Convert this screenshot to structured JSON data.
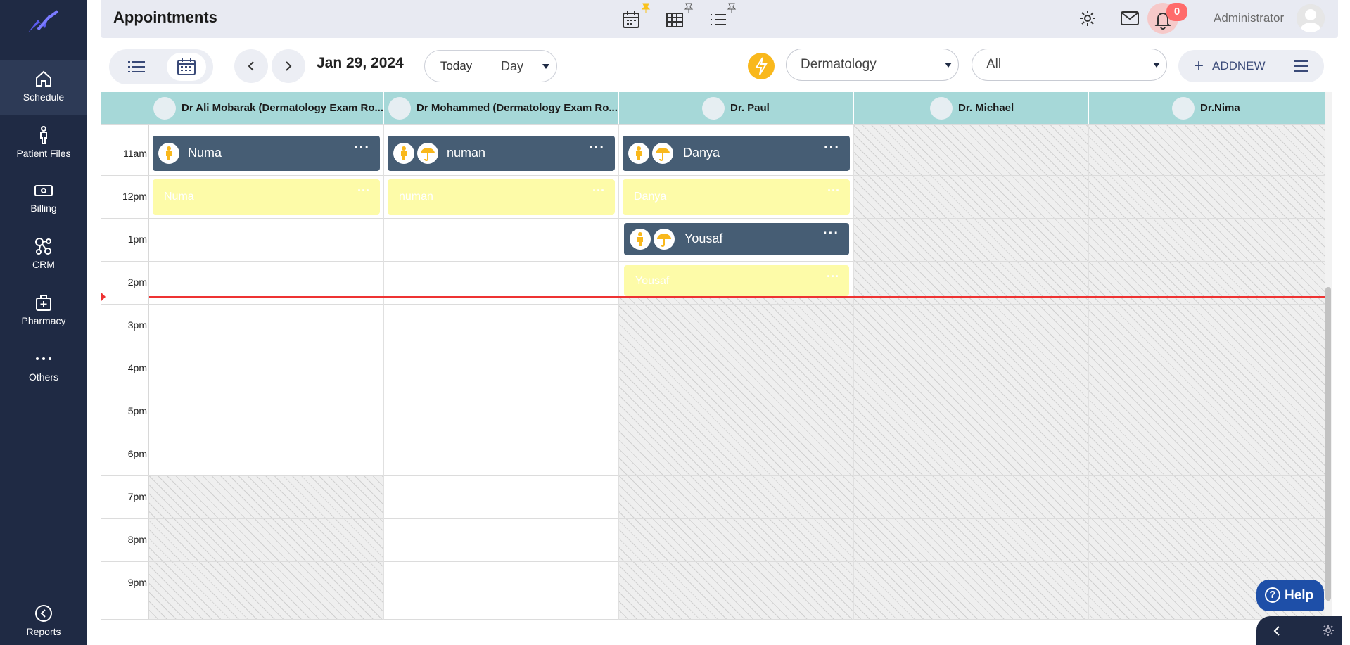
{
  "app": {
    "title": "Appointments"
  },
  "sidebar": {
    "items": [
      {
        "label": "Schedule",
        "icon": "home-icon"
      },
      {
        "label": "Patient Files",
        "icon": "person-icon"
      },
      {
        "label": "Billing",
        "icon": "money-icon"
      },
      {
        "label": "CRM",
        "icon": "network-icon"
      },
      {
        "label": "Pharmacy",
        "icon": "medkit-icon"
      },
      {
        "label": "Others",
        "icon": "dots-icon"
      }
    ],
    "reports": {
      "label": "Reports",
      "icon": "back-circle-icon"
    }
  },
  "header": {
    "notifications_count": "0",
    "user_name": "Administrator"
  },
  "toolbar": {
    "date": "Jan 29, 2024",
    "today_label": "Today",
    "view_label": "Day",
    "department": "Dermatology",
    "filter": "All",
    "add_new_label": "ADDNEW"
  },
  "calendar": {
    "columns": [
      "Dr Ali Mobarak (Dermatology Exam Ro...",
      "Dr Mohammed (Dermatology Exam Ro...",
      "Dr. Paul",
      "Dr. Michael",
      "Dr.Nima"
    ],
    "time_labels": [
      "11am",
      "12pm",
      "1pm",
      "2pm",
      "3pm",
      "4pm",
      "5pm",
      "6pm",
      "7pm",
      "8pm",
      "9pm"
    ],
    "appointments": [
      {
        "name": "Numa",
        "pending_name": "Numa"
      },
      {
        "name": "numan",
        "pending_name": "numan"
      },
      {
        "name": "Danya",
        "pending_name": "Danya"
      },
      {
        "name": "Yousaf",
        "pending_name": "Yousaf"
      }
    ]
  },
  "help": {
    "label": "Help"
  },
  "colors": {
    "sidebar": "#1f2a44",
    "header_cell": "#a6d8d8",
    "appointment": "#465d74",
    "pending": "#fdfba8",
    "accent": "#f9b81c",
    "now_line": "#ee3333"
  }
}
